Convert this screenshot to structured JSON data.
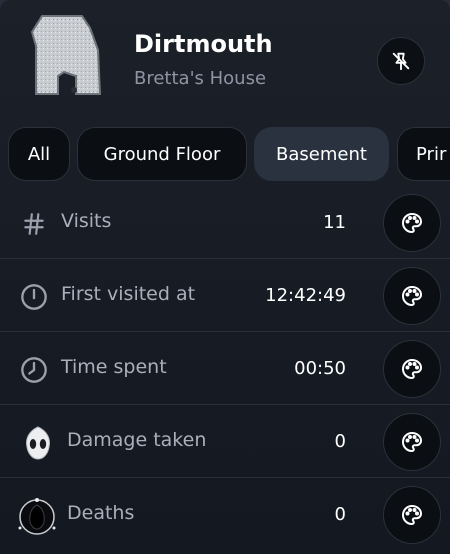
{
  "header": {
    "title": "Dirtmouth",
    "subtitle": "Bretta's House",
    "map_icon": "map-room-icon",
    "pin_icon": "pin-off-icon"
  },
  "tabs": [
    {
      "label": "All",
      "active": false
    },
    {
      "label": "Ground Floor",
      "active": false
    },
    {
      "label": "Basement",
      "active": true
    },
    {
      "label": "Prir",
      "active": false
    }
  ],
  "stats": [
    {
      "icon": "hash-icon",
      "label": "Visits",
      "value": "11"
    },
    {
      "icon": "clock-alert-icon",
      "label": "First visited at",
      "value": "12:42:49"
    },
    {
      "icon": "clock-icon",
      "label": "Time spent",
      "value": "00:50"
    },
    {
      "icon": "mask-icon",
      "label": "Damage taken",
      "value": "0"
    },
    {
      "icon": "shade-icon",
      "label": "Deaths",
      "value": "0"
    }
  ],
  "colors": {
    "background": "#161a22",
    "active_tab": "#2a3240",
    "label_text": "#a9b0bc",
    "value_text": "#ffffff"
  }
}
